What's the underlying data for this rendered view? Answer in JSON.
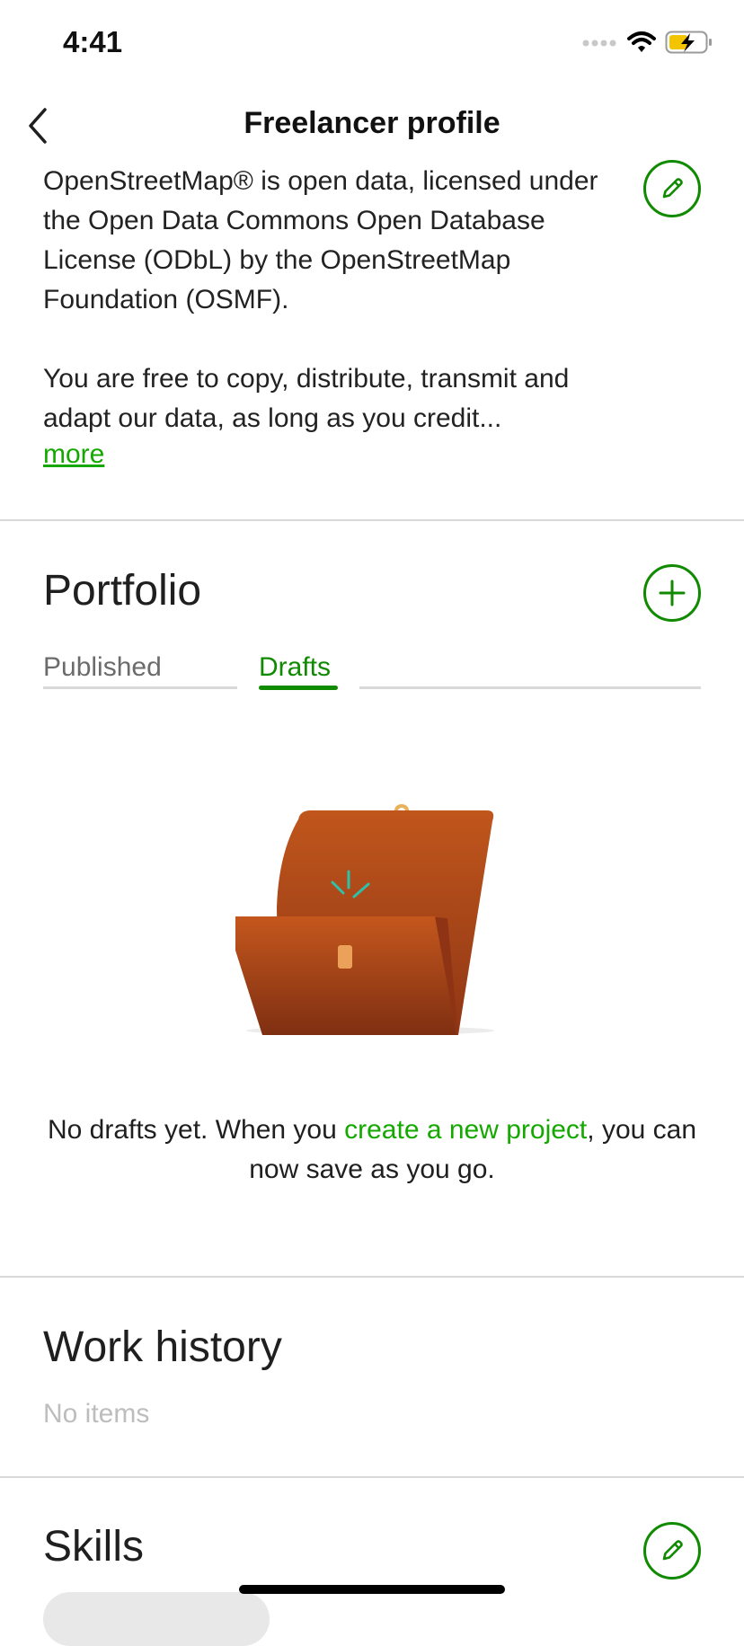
{
  "status_bar": {
    "time": "4:41"
  },
  "nav": {
    "title": "Freelancer profile"
  },
  "about": {
    "paragraph1": "OpenStreetMap® is open data, licensed under the Open Data Commons Open Database License (ODbL) by the OpenStreetMap Foundation (OSMF).",
    "paragraph2": "You are free to copy, distribute, transmit and adapt our data, as long as you credit...",
    "more_label": "more"
  },
  "portfolio": {
    "title": "Portfolio",
    "tabs": [
      {
        "label": "Published",
        "active": false
      },
      {
        "label": "Drafts",
        "active": true
      }
    ],
    "empty_prefix": "No drafts yet. When you ",
    "empty_link": "create a new project",
    "empty_suffix": ", you can now save as you go."
  },
  "work_history": {
    "title": "Work history",
    "empty_label": "No items"
  },
  "skills": {
    "title": "Skills"
  },
  "colors": {
    "accent": "#108a00",
    "link": "#14a800",
    "divider": "#d9d9d9"
  }
}
